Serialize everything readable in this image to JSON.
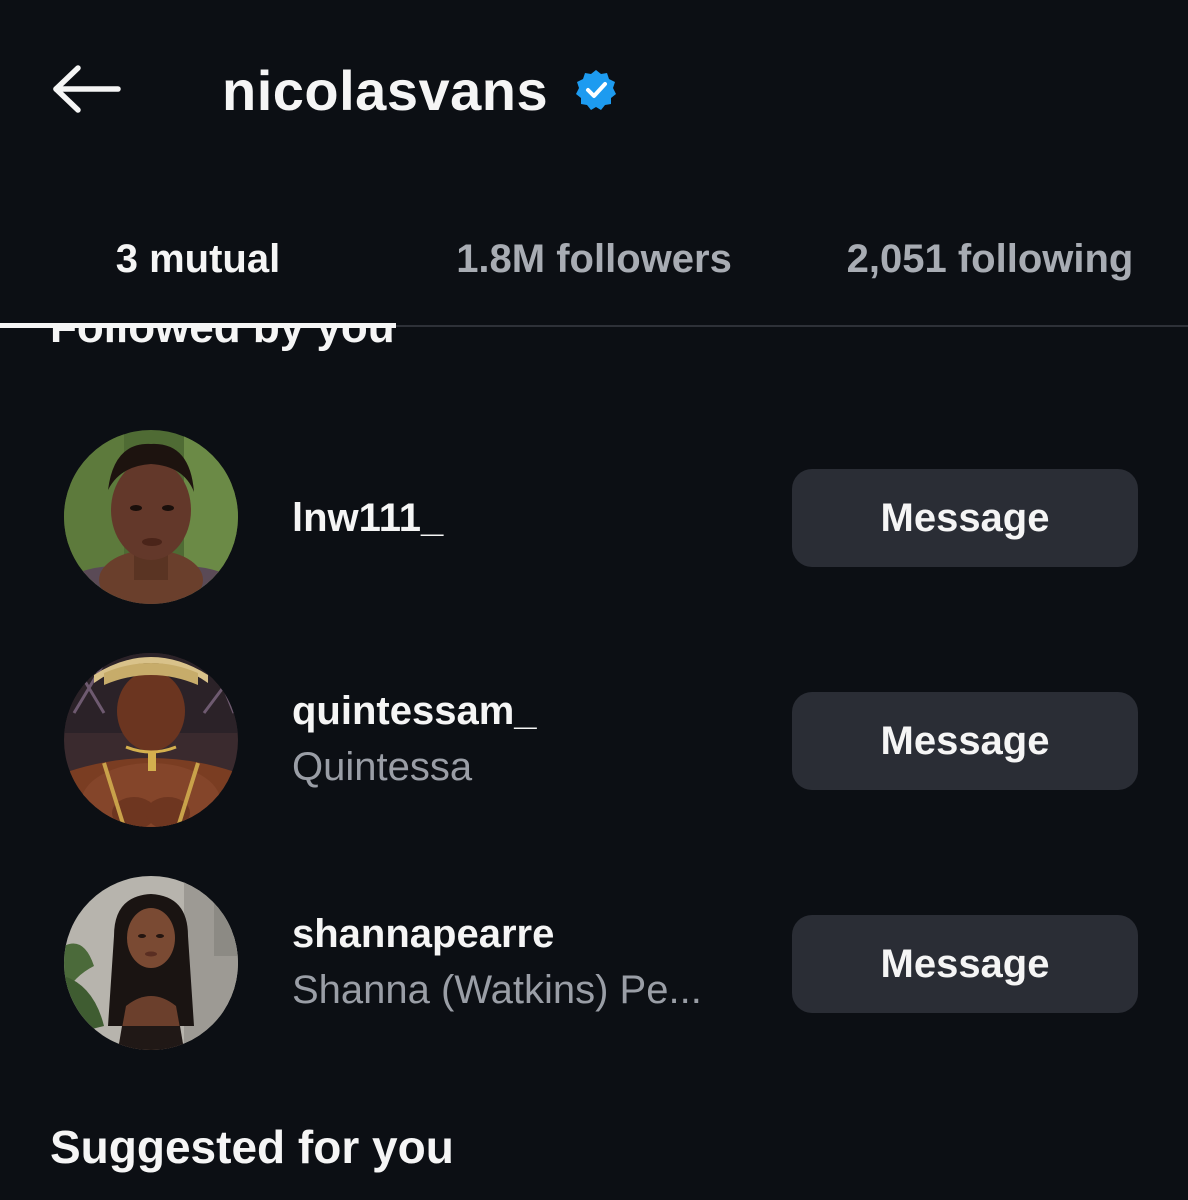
{
  "header": {
    "title": "nicolasvans",
    "verified": true,
    "back_icon": "arrow-left-icon",
    "verified_icon": "verified-badge-icon",
    "verified_color": "#1d9bf0"
  },
  "tabs": [
    {
      "label": "3 mutual",
      "active": true
    },
    {
      "label": "1.8M followers",
      "active": false
    },
    {
      "label": "2,051 following",
      "active": false
    }
  ],
  "sections": {
    "followed_by_you": "Followed by you",
    "suggested": "Suggested for you"
  },
  "users": [
    {
      "username": "lnw111_",
      "full_name": "",
      "button_label": "Message"
    },
    {
      "username": "quintessam_",
      "full_name": "Quintessa",
      "button_label": "Message"
    },
    {
      "username": "shannapearre",
      "full_name": "Shanna (Watkins) Pe...",
      "button_label": "Message"
    }
  ],
  "colors": {
    "background": "#0c0f14",
    "button_bg": "#2a2d35",
    "secondary_text": "#9a9ea6"
  }
}
